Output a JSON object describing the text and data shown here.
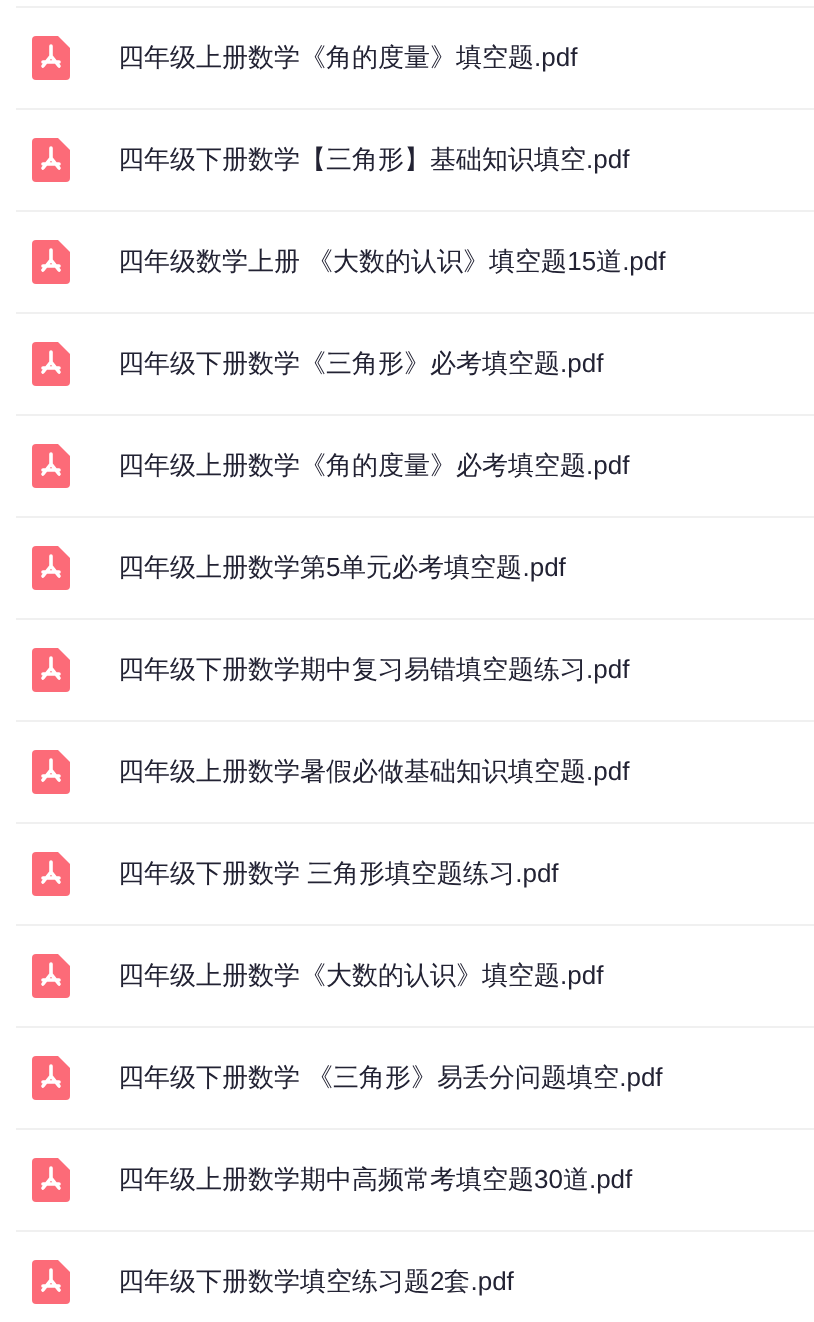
{
  "files": [
    {
      "name": "四年级上册数学《角的度量》填空题.pdf"
    },
    {
      "name": "四年级下册数学【三角形】基础知识填空.pdf"
    },
    {
      "name": "四年级数学上册 《大数的认识》填空题15道.pdf"
    },
    {
      "name": "四年级下册数学《三角形》必考填空题.pdf"
    },
    {
      "name": "四年级上册数学《角的度量》必考填空题.pdf"
    },
    {
      "name": "四年级上册数学第5单元必考填空题.pdf"
    },
    {
      "name": "四年级下册数学期中复习易错填空题练习.pdf"
    },
    {
      "name": "四年级上册数学暑假必做基础知识填空题.pdf"
    },
    {
      "name": "四年级下册数学 三角形填空题练习.pdf"
    },
    {
      "name": "四年级上册数学《大数的认识》填空题.pdf"
    },
    {
      "name": "四年级下册数学 《三角形》易丢分问题填空.pdf"
    },
    {
      "name": "四年级上册数学期中高频常考填空题30道.pdf"
    },
    {
      "name": "四年级下册数学填空练习题2套.pdf"
    }
  ]
}
